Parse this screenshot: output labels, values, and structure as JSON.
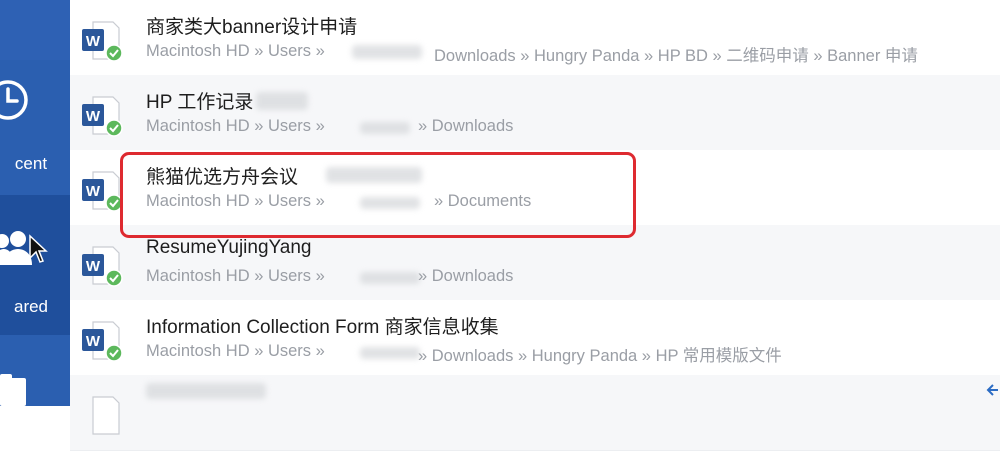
{
  "sidebar": {
    "items": [
      {
        "label": "cent",
        "icon": "clock-icon"
      },
      {
        "label": "ared",
        "icon": "people-icon"
      }
    ],
    "partial_item_icon": "folder-icon"
  },
  "files": [
    {
      "name": "商家类大banner设计申请",
      "path_left": "Macintosh HD » Users »",
      "path_right": "Downloads » Hungry Panda » HP BD » 二维码申请 » Banner 申请"
    },
    {
      "name": "HP 工作记录",
      "path_left": "Macintosh HD » Users »",
      "path_right": "» Downloads"
    },
    {
      "name": "熊猫优选方舟会议",
      "path_left": "Macintosh HD » Users »",
      "path_right": "» Documents"
    },
    {
      "name": "ResumeYujingYang",
      "path_left": "Macintosh HD » Users »",
      "path_right": "» Downloads"
    },
    {
      "name": "Information Collection Form 商家信息收集",
      "path_left": "Macintosh HD » Users »",
      "path_right": "» Downloads » Hungry Panda » HP 常用模版文件"
    }
  ],
  "colors": {
    "sidebar": "#2b5fb0",
    "highlight": "#de2a30",
    "word_blue": "#2b579a",
    "sync_green": "#5cb85c"
  }
}
